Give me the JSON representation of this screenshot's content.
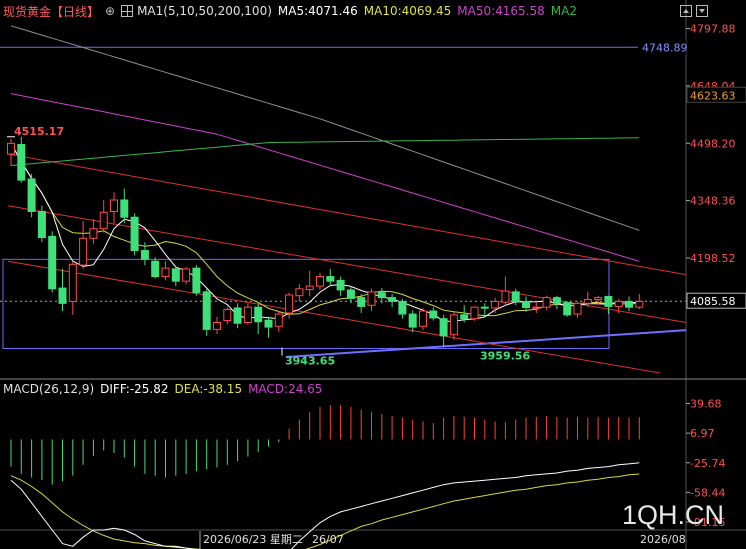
{
  "header": {
    "instrument": "现货黄金【日线】",
    "target_icon": "⊕",
    "ma_title": "MA1(5,10,50,200,100)",
    "ma5": "MA5:4071.46",
    "ma10": "MA10:4069.45",
    "ma50": "MA50:4165.58",
    "ma2": "MA2"
  },
  "macd_header": {
    "title": "MACD(26,12,9)",
    "diff": "DIFF:-25.82",
    "dea": "DEA:-38.15",
    "macd": "MACD:24.65"
  },
  "colors": {
    "up": "#ff4a4a",
    "down": "#3fe07a",
    "ma5": "#ffffff",
    "ma10": "#d8d83a",
    "ma50": "#d040d0",
    "ma100": "#909090",
    "ma200": "#36b84a",
    "trend": "#e03030",
    "box": "#6a6aff"
  },
  "watermark": "1QH.CN",
  "chart_data": [
    {
      "type": "candlestick",
      "title": "现货黄金【日线】",
      "y_ticks": [
        4797.88,
        4648.04,
        4498.2,
        4348.36,
        4198.52
      ],
      "ylim": [
        3885,
        4815
      ],
      "price_labels": {
        "ma100_level": "4748.89",
        "ma50_level": "4623.63",
        "last": "4085.58"
      },
      "annotations": {
        "high": "4515.17",
        "low1": "3943.65",
        "low2": "3959.56"
      },
      "x_labels": [
        "2026/06/23 星期二",
        "26/07",
        "2026/08"
      ],
      "candles": [
        [
          4470,
          4498,
          4440,
          4510
        ],
        [
          4495,
          4402,
          4395,
          4515
        ],
        [
          4405,
          4320,
          4305,
          4418
        ],
        [
          4320,
          4252,
          4240,
          4335
        ],
        [
          4255,
          4118,
          4108,
          4268
        ],
        [
          4120,
          4080,
          4060,
          4170
        ],
        [
          4085,
          4182,
          4050,
          4190
        ],
        [
          4180,
          4250,
          4170,
          4295
        ],
        [
          4250,
          4275,
          4235,
          4300
        ],
        [
          4275,
          4318,
          4265,
          4350
        ],
        [
          4320,
          4350,
          4290,
          4370
        ],
        [
          4350,
          4305,
          4290,
          4380
        ],
        [
          4305,
          4218,
          4205,
          4315
        ],
        [
          4218,
          4195,
          4180,
          4240
        ],
        [
          4190,
          4150,
          4145,
          4200
        ],
        [
          4150,
          4172,
          4140,
          4190
        ],
        [
          4170,
          4138,
          4125,
          4175
        ],
        [
          4138,
          4170,
          4130,
          4175
        ],
        [
          4172,
          4108,
          4100,
          4180
        ],
        [
          4110,
          4012,
          3995,
          4118
        ],
        [
          4012,
          4030,
          4000,
          4045
        ],
        [
          4035,
          4064,
          4025,
          4070
        ],
        [
          4068,
          4028,
          4015,
          4080
        ],
        [
          4030,
          4070,
          4025,
          4080
        ],
        [
          4070,
          4032,
          4000,
          4080
        ],
        [
          4036,
          4018,
          3990,
          4045
        ],
        [
          4020,
          4052,
          4005,
          4060
        ],
        [
          4055,
          4102,
          4040,
          4108
        ],
        [
          4100,
          4118,
          4085,
          4130
        ],
        [
          4116,
          4125,
          4098,
          4165
        ],
        [
          4125,
          4150,
          4115,
          4160
        ],
        [
          4150,
          4138,
          4125,
          4170
        ],
        [
          4140,
          4115,
          4100,
          4150
        ],
        [
          4115,
          4093,
          4080,
          4125
        ],
        [
          4095,
          4072,
          4055,
          4105
        ],
        [
          4075,
          4110,
          4060,
          4118
        ],
        [
          4108,
          4095,
          4080,
          4120
        ],
        [
          4095,
          4085,
          4070,
          4105
        ],
        [
          4085,
          4052,
          4040,
          4092
        ],
        [
          4052,
          4018,
          4005,
          4062
        ],
        [
          4020,
          4060,
          4010,
          4068
        ],
        [
          4060,
          4042,
          4035,
          4070
        ],
        [
          4040,
          3995,
          3965,
          4050
        ],
        [
          3998,
          4050,
          3985,
          4058
        ],
        [
          4050,
          4040,
          4030,
          4075
        ],
        [
          4040,
          4070,
          4035,
          4072
        ],
        [
          4070,
          4068,
          4045,
          4080
        ],
        [
          4068,
          4085,
          4055,
          4095
        ],
        [
          4083,
          4112,
          4075,
          4150
        ],
        [
          4110,
          4085,
          4075,
          4118
        ],
        [
          4085,
          4069,
          4058,
          4098
        ],
        [
          4069,
          4070,
          4055,
          4085
        ],
        [
          4070,
          4095,
          4062,
          4100
        ],
        [
          4095,
          4080,
          4065,
          4100
        ],
        [
          4082,
          4050,
          4045,
          4085
        ],
        [
          4052,
          4080,
          4042,
          4085
        ],
        [
          4080,
          4090,
          4070,
          4110
        ],
        [
          4090,
          4095,
          4075,
          4100
        ],
        [
          4098,
          4072,
          4052,
          4100
        ],
        [
          4072,
          4085,
          4055,
          4092
        ],
        [
          4085,
          4070,
          4060,
          4098
        ],
        [
          4070,
          4085,
          4065,
          4105
        ]
      ]
    },
    {
      "type": "bar",
      "title": "MACD(26,12,9)",
      "y_ticks": [
        39.68,
        6.97,
        -25.74,
        -58.44,
        -91.15
      ],
      "ylim": [
        -100,
        48
      ],
      "histogram": [
        -30,
        -38,
        -42,
        -45,
        -50,
        -46,
        -40,
        -28,
        -18,
        -12,
        -15,
        -20,
        -30,
        -38,
        -40,
        -42,
        -40,
        -38,
        -35,
        -33,
        -31,
        -28,
        -24,
        -19,
        -14,
        -8,
        -3,
        12,
        22,
        30,
        36,
        38,
        38,
        36,
        33,
        30,
        28,
        26,
        24,
        22,
        20,
        18,
        24,
        26,
        25,
        24,
        22,
        20,
        19,
        22,
        24,
        25,
        26,
        25,
        24,
        25,
        24,
        25,
        24,
        25,
        24,
        24.65
      ],
      "diff": [
        -45,
        -55,
        -70,
        -85,
        -100,
        -115,
        -118,
        -108,
        -100,
        -100,
        -98,
        -100,
        -105,
        -112,
        -115,
        -118,
        -118,
        -120,
        -122,
        -124,
        -126,
        -128,
        -130,
        -130,
        -130,
        -129,
        -128,
        -124,
        -112,
        -102,
        -92,
        -85,
        -80,
        -77,
        -74,
        -71,
        -68,
        -65,
        -62,
        -59,
        -56,
        -53,
        -50,
        -48,
        -47,
        -46,
        -45,
        -44,
        -43,
        -42,
        -40,
        -39,
        -38,
        -37,
        -35,
        -34,
        -32,
        -31,
        -30,
        -28,
        -27,
        -25.82
      ],
      "dea": [
        -40,
        -45,
        -52,
        -60,
        -70,
        -80,
        -88,
        -95,
        -101,
        -106,
        -110,
        -112,
        -114,
        -115,
        -117,
        -118,
        -119,
        -120,
        -121,
        -122,
        -123,
        -124,
        -125,
        -126,
        -127,
        -128,
        -128,
        -126,
        -124,
        -120,
        -116,
        -111,
        -106,
        -101,
        -96,
        -93,
        -89,
        -86,
        -83,
        -80,
        -77,
        -74,
        -71,
        -68,
        -66,
        -64,
        -62,
        -60,
        -58,
        -56,
        -55,
        -53,
        -51,
        -50,
        -48,
        -47,
        -45,
        -44,
        -42,
        -41,
        -39,
        -38.15
      ]
    }
  ]
}
